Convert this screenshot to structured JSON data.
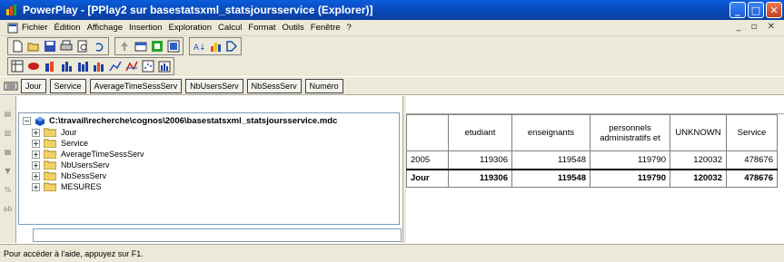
{
  "window": {
    "title": "PowerPlay - [PPlay2 sur basestatsxml_statsjoursservice (Explorer)]"
  },
  "menu": {
    "items": [
      "Fichier",
      "Édition",
      "Affichage",
      "Insertion",
      "Exploration",
      "Calcul",
      "Format",
      "Outils",
      "Fenêtre",
      "?"
    ]
  },
  "toolbar1": {
    "icons": [
      "new-icon",
      "open-icon",
      "save-icon",
      "print-icon",
      "print-preview-icon",
      "undo-icon",
      "drill-up-icon",
      "drill-down-icon",
      "filter-icon",
      "swap-icon",
      "sort-icon",
      "rank-icon",
      "refresh-icon"
    ]
  },
  "toolbar2": {
    "icons": [
      "crosstab-icon",
      "pie-icon",
      "3d-bar-icon",
      "bar-icon",
      "stacked-bar-icon",
      "clustered-bar-icon",
      "line-icon",
      "correlation-icon",
      "scatter-icon",
      "multi-bar-icon"
    ]
  },
  "dimension_line": {
    "items": [
      "Jour",
      "Service",
      "AverageTimeSessServ",
      "NbUsersServ",
      "NbSessServ",
      "Numéro"
    ]
  },
  "tree": {
    "root": "C:\\travail\\recherche\\cognos\\2006\\basestatsxml_statsjoursservice.mdc",
    "nodes": [
      "Jour",
      "Service",
      "AverageTimeSessServ",
      "NbUsersServ",
      "NbSessServ",
      "MESURES"
    ]
  },
  "crosstab": {
    "columns": [
      "etudiant",
      "enseignants",
      "personnels administratifs et",
      "UNKNOWN",
      "Service"
    ],
    "rows": [
      {
        "label": "2005",
        "values": [
          "119306",
          "119548",
          "119790",
          "120032",
          "478676"
        ]
      },
      {
        "label": "Jour",
        "values": [
          "119306",
          "119548",
          "119790",
          "120032",
          "478676"
        ]
      }
    ]
  },
  "status": {
    "text": "Pour accéder à l'aide, appuyez sur F1."
  },
  "colors": {
    "titlebar": "#0a5ddc",
    "chrome": "#ece9d8"
  }
}
